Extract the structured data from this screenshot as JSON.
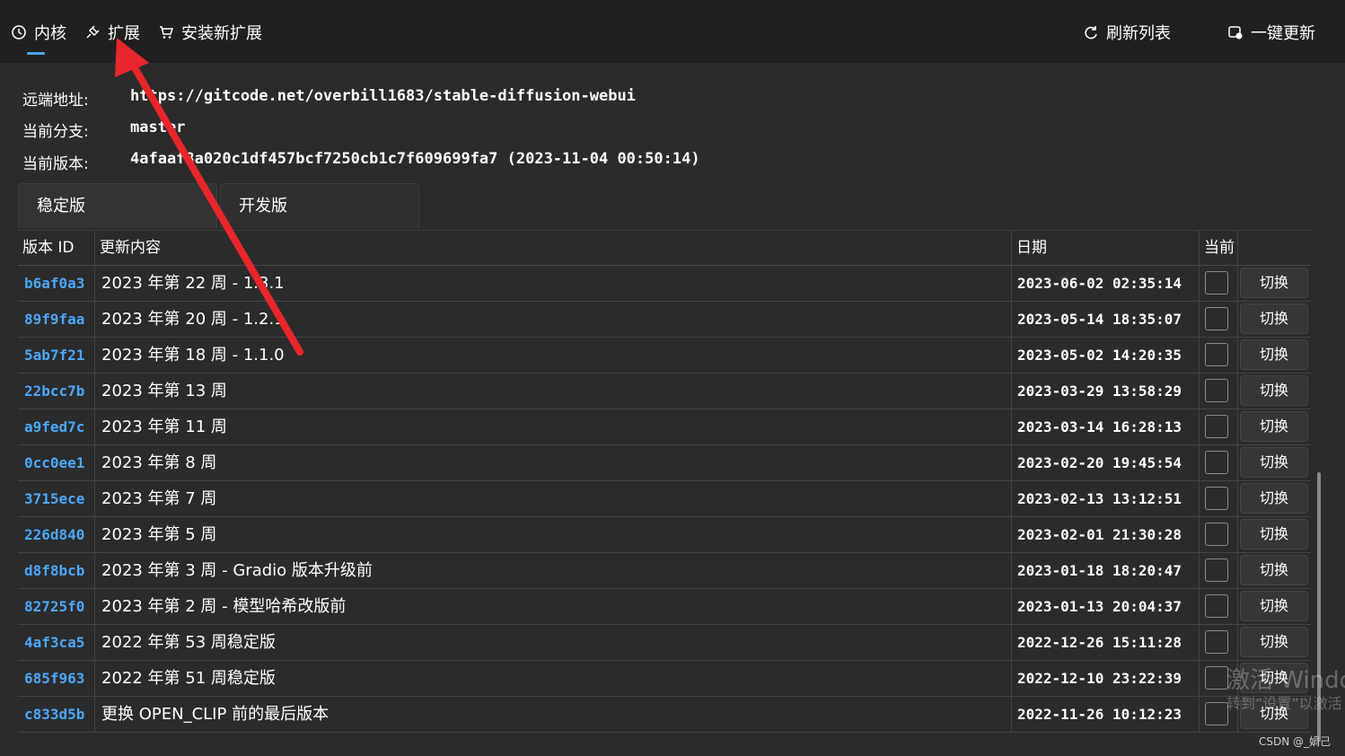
{
  "nav": {
    "kernel_label": "内核",
    "extensions_label": "扩展",
    "install_label": "安装新扩展",
    "refresh_label": "刷新列表",
    "update_all_label": "一键更新"
  },
  "info": {
    "remote_label": "远端地址:",
    "remote_value": "https://gitcode.net/overbill1683/stable-diffusion-webui",
    "branch_label": "当前分支:",
    "branch_value": "master",
    "version_label": "当前版本:",
    "version_value": "4afaaf8a020c1df457bcf7250cb1c7f609699fa7 (2023-11-04 00:50:14)"
  },
  "tabs": [
    "稳定版",
    "开发版"
  ],
  "table": {
    "headers": {
      "id": "版本 ID",
      "desc": "更新内容",
      "date": "日期",
      "current": "当前"
    },
    "switch_label": "切换",
    "rows": [
      {
        "id": "b6af0a3",
        "desc": "2023 年第 22 周 - 1.3.1",
        "date": "2023-06-02 02:35:14"
      },
      {
        "id": "89f9faa",
        "desc": "2023 年第 20 周 - 1.2.1",
        "date": "2023-05-14 18:35:07"
      },
      {
        "id": "5ab7f21",
        "desc": "2023 年第 18 周 - 1.1.0",
        "date": "2023-05-02 14:20:35"
      },
      {
        "id": "22bcc7b",
        "desc": "2023 年第 13 周",
        "date": "2023-03-29 13:58:29"
      },
      {
        "id": "a9fed7c",
        "desc": "2023 年第 11 周",
        "date": "2023-03-14 16:28:13"
      },
      {
        "id": "0cc0ee1",
        "desc": "2023 年第 8 周",
        "date": "2023-02-20 19:45:54"
      },
      {
        "id": "3715ece",
        "desc": "2023 年第 7 周",
        "date": "2023-02-13 13:12:51"
      },
      {
        "id": "226d840",
        "desc": "2023 年第 5 周",
        "date": "2023-02-01 21:30:28"
      },
      {
        "id": "d8f8bcb",
        "desc": "2023 年第 3 周 - Gradio 版本升级前",
        "date": "2023-01-18 18:20:47"
      },
      {
        "id": "82725f0",
        "desc": "2023 年第 2 周 - 模型哈希改版前",
        "date": "2023-01-13 20:04:37"
      },
      {
        "id": "4af3ca5",
        "desc": "2022 年第 53 周稳定版",
        "date": "2022-12-26 15:11:28"
      },
      {
        "id": "685f963",
        "desc": "2022 年第 51 周稳定版",
        "date": "2022-12-10 23:22:39"
      },
      {
        "id": "c833d5b",
        "desc": "更换 OPEN_CLIP 前的最后版本",
        "date": "2022-11-26 10:12:23"
      }
    ]
  },
  "watermark": {
    "line1": "激活 Windo",
    "line2": "转到“设置”以激活"
  },
  "credit": "CSDN @_娟己",
  "colors": {
    "accent": "#4aa8ff",
    "annotation_arrow": "#e8262b"
  }
}
